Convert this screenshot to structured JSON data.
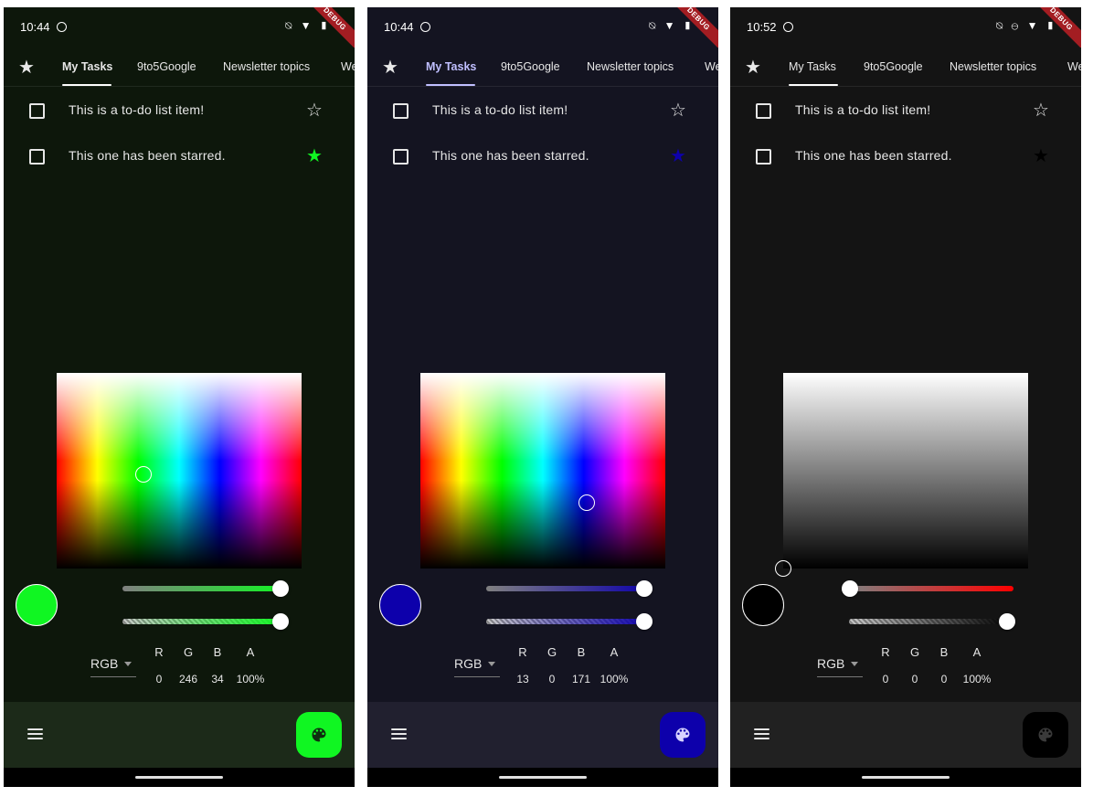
{
  "screens": [
    {
      "id": "green",
      "time": "10:44",
      "status_icons": "⍉ ▼ ▮",
      "debug_label": "DEBUG",
      "colors": {
        "background": "#0d170b",
        "bottombar": "#1c2a19",
        "accent": "#10f622",
        "fab_icon": "#0f2d10",
        "tab_underline": "#ffffff"
      },
      "tabs": [
        "My Tasks",
        "9to5Google",
        "Newsletter topics",
        "We"
      ],
      "tasks": [
        {
          "label": "This is a to-do list item!",
          "starred": false
        },
        {
          "label": "This one has been starred.",
          "starred": true
        }
      ],
      "picker": {
        "hue_mode": true,
        "cursor_hint": "green-yellow area"
      },
      "color_model": "RGB",
      "channels": [
        "R",
        "G",
        "B",
        "A"
      ],
      "values": [
        "0",
        "246",
        "34",
        "100%"
      ],
      "sliders": {
        "lightness": 1.0,
        "alpha": 1.0
      }
    },
    {
      "id": "blue",
      "time": "10:44",
      "status_icons": "⍉ ▼ ▮",
      "debug_label": "DEBUG",
      "colors": {
        "background": "#141421",
        "bottombar": "#21202f",
        "accent": "#0d00ab",
        "fab_icon": "#d6d2ff",
        "tab_underline": "#c0bfff"
      },
      "tabs": [
        "My Tasks",
        "9to5Google",
        "Newsletter topics",
        "We"
      ],
      "tasks": [
        {
          "label": "This is a to-do list item!",
          "starred": false
        },
        {
          "label": "This one has been starred.",
          "starred": true
        }
      ],
      "picker": {
        "hue_mode": true,
        "cursor_hint": "blue area"
      },
      "color_model": "RGB",
      "channels": [
        "R",
        "G",
        "B",
        "A"
      ],
      "values": [
        "13",
        "0",
        "171",
        "100%"
      ],
      "sliders": {
        "lightness": 1.0,
        "alpha": 1.0
      }
    },
    {
      "id": "black",
      "time": "10:52",
      "status_icons": "⍉ ⊖ ▼ ▮",
      "debug_label": "DEBUG",
      "colors": {
        "background": "#141414",
        "bottombar": "#212121",
        "accent": "#000000",
        "fab_icon": "#3a3a3a",
        "tab_underline": "#ffffff"
      },
      "tabs": [
        "My Tasks",
        "9to5Google",
        "Newsletter topics",
        "We"
      ],
      "tasks": [
        {
          "label": "This is a to-do list item!",
          "starred": false
        },
        {
          "label": "This one has been starred.",
          "starred": true
        }
      ],
      "picker": {
        "hue_mode": false,
        "cursor_hint": "bottom-left corner"
      },
      "color_model": "RGB",
      "channels": [
        "R",
        "G",
        "B",
        "A"
      ],
      "values": [
        "0",
        "0",
        "0",
        "100%"
      ],
      "sliders": {
        "lightness": 0.0,
        "alpha": 1.0
      }
    }
  ]
}
